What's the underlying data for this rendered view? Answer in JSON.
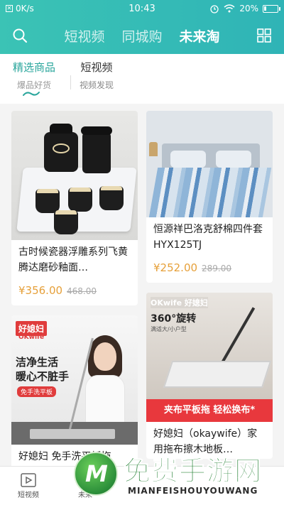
{
  "status_bar": {
    "network_speed": "0K/s",
    "time": "10:43",
    "battery_percent": "20%",
    "battery_level": 0.2
  },
  "top_nav": {
    "search_icon": "search-icon",
    "tabs": [
      {
        "label": "短视频",
        "active": false
      },
      {
        "label": "同城购",
        "active": false
      },
      {
        "label": "未来淘",
        "active": true
      }
    ],
    "grid_icon": "grid-icon"
  },
  "sub_tabs": [
    {
      "label": "精选商品",
      "sublabel": "爆品好货",
      "active": true
    },
    {
      "label": "短视频",
      "sublabel": "视频发现",
      "active": false
    }
  ],
  "products": [
    {
      "title": "古时候瓷器浮雕系列飞黄腾达磨砂釉面…",
      "price": "¥356.00",
      "original_price": "468.00",
      "image": "tea-set"
    },
    {
      "title": "恒源祥巴洛克舒棉四件套HYX125TJ",
      "price": "¥252.00",
      "original_price": "289.00",
      "image": "bedding"
    },
    {
      "title": "好媳妇 免手洗平板拖",
      "price": "",
      "original_price": "",
      "image": "mop-1",
      "image_text": {
        "brand": "好媳妇",
        "brand_en": "OKwife",
        "line1": "洁净生活",
        "line2": "暖心不脏手",
        "chip": "免手洗平板"
      }
    },
    {
      "title": "好媳妇（okaywife）家用拖布擦木地板…",
      "price": "",
      "original_price": "",
      "image": "mop-2",
      "image_text": {
        "brand": "OKwife 好媳妇",
        "headline": "360°旋转",
        "sub": "满适大/小户型",
        "banner": "夹布平板拖 轻松换布*"
      }
    }
  ],
  "bottom_bar": [
    {
      "label": "短视频",
      "icon": "play-icon"
    },
    {
      "label": "未来",
      "icon": "home-icon"
    }
  ],
  "watermark": {
    "letter": "M",
    "text_cn": "免费手游网",
    "text_en": "MIANFEISHOUYOUWANG"
  },
  "colors": {
    "header_teal": "#3bc3b5",
    "active_green": "#2aa69c",
    "price_orange": "#e6a03a",
    "banner_red": "#e8383d"
  }
}
